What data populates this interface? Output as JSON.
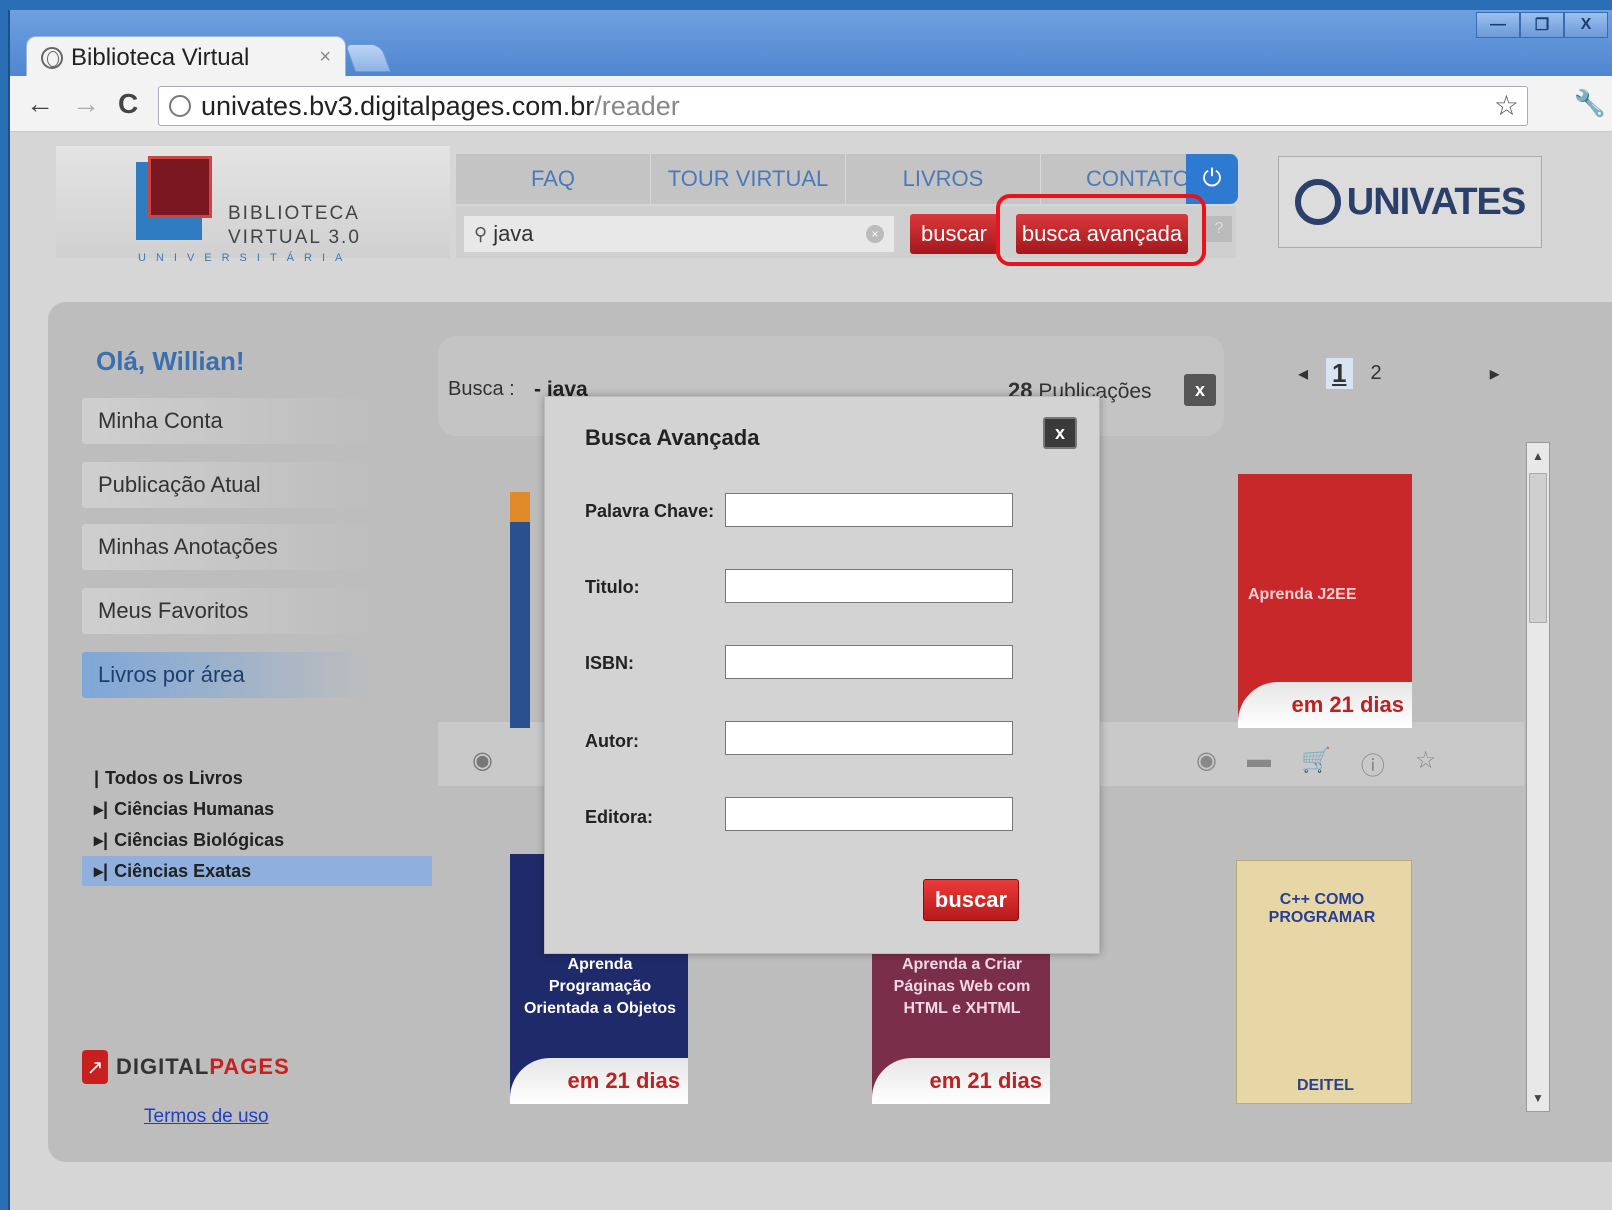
{
  "browser": {
    "tab_title": "Biblioteca Virtual",
    "tab_close": "×",
    "url_host": "univates.bv3.digitalpages.com.br",
    "url_path": "/reader",
    "back": "←",
    "forward": "→",
    "reload": "C",
    "star": "☆",
    "wrench": "🔧",
    "win_min": "—",
    "win_max": "❐",
    "win_close": "X"
  },
  "header": {
    "logo_line1": "BIBLIOTECA",
    "logo_line2": "VIRTUAL 3.0",
    "logo_sub": "UNIVERSITÁRIA",
    "nav": [
      "FAQ",
      "TOUR VIRTUAL",
      "LIVROS",
      "CONTATO"
    ],
    "power_icon": "⏻",
    "search_value": "java",
    "search_clear": "×",
    "buscar_label": "buscar",
    "busca_avancada_label": "busca avançada",
    "help_label": "?",
    "univates": "UNIVATES"
  },
  "sidebar": {
    "greeting": "Olá, Willian!",
    "items": [
      "Minha Conta",
      "Publicação Atual",
      "Minhas Anotações",
      "Meus Favoritos",
      "Livros por área"
    ],
    "tree": [
      {
        "prefix": "|",
        "label": "Todos os Livros"
      },
      {
        "prefix": "▸|",
        "label": "Ciências Humanas"
      },
      {
        "prefix": "▸|",
        "label": "Ciências Biológicas"
      },
      {
        "prefix": "▸|",
        "label": "Ciências Exatas"
      }
    ],
    "dp_logo_a": "DIGITAL",
    "dp_logo_b": "PAGES",
    "dp_mark": "↗",
    "terms": "Termos de uso"
  },
  "results": {
    "busca_label": "Busca :",
    "busca_term": "- java",
    "count": "28",
    "count_label": "Publicações",
    "clear": "x",
    "pager": {
      "prev": "◂",
      "pages": [
        "1",
        "2"
      ],
      "current": "1",
      "next": "▸"
    },
    "icons": {
      "view": "◉",
      "print": "▬",
      "cart": "🛒",
      "info": "ⓘ",
      "fav": "☆"
    }
  },
  "books": [
    {
      "title": "Aprenda J2EE",
      "edition": "em 21 dias",
      "color": "#c9282b"
    },
    {
      "title": "Aprenda Programação Orientada a Objetos",
      "edition": "em 21 dias",
      "color": "#1f2a6a"
    },
    {
      "title": "Aprenda a Criar Páginas Web com HTML e XHTML",
      "edition": "em 21 dias",
      "color": "#7a2e4a"
    },
    {
      "title": "C++ COMO PROGRAMAR",
      "edition": "DEITEL",
      "color": "#e7d7a6"
    }
  ],
  "modal": {
    "title": "Busca Avançada",
    "close": "x",
    "fields": [
      "Palavra Chave:",
      "Titulo:",
      "ISBN:",
      "Autor:",
      "Editora:"
    ],
    "submit": "buscar"
  }
}
